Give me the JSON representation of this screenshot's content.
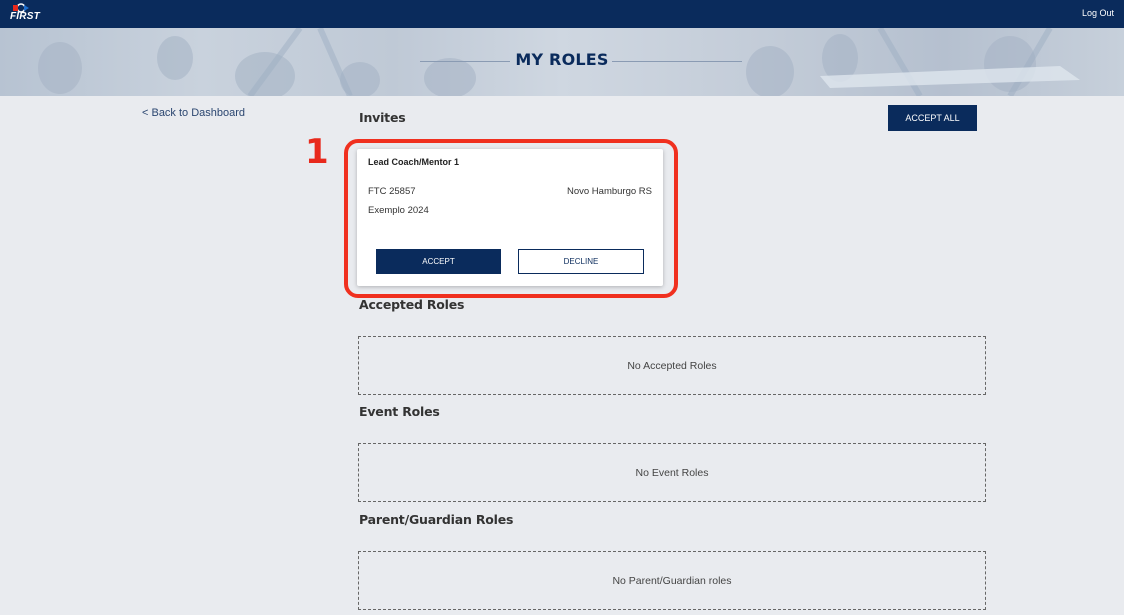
{
  "header": {
    "logo_text": "FIRST",
    "logout_label": "Log Out"
  },
  "banner": {
    "title": "MY ROLES"
  },
  "nav": {
    "back_label": "< Back to Dashboard"
  },
  "invites": {
    "title": "Invites",
    "accept_all_label": "ACCEPT ALL",
    "annotation_number": "1",
    "items": [
      {
        "role": "Lead Coach/Mentor 1",
        "team": "FTC 25857",
        "location": "Novo Hamburgo RS",
        "team_name": "Exemplo 2024",
        "accept_label": "ACCEPT",
        "decline_label": "DECLINE"
      }
    ]
  },
  "accepted_roles": {
    "title": "Accepted Roles",
    "empty_text": "No Accepted Roles"
  },
  "event_roles": {
    "title": "Event Roles",
    "empty_text": "No Event Roles"
  },
  "parent_roles": {
    "title": "Parent/Guardian Roles",
    "empty_text": "No Parent/Guardian roles"
  },
  "colors": {
    "navy": "#0a2b5c",
    "highlight_red": "#f0301f",
    "background": "#e9ebef"
  }
}
